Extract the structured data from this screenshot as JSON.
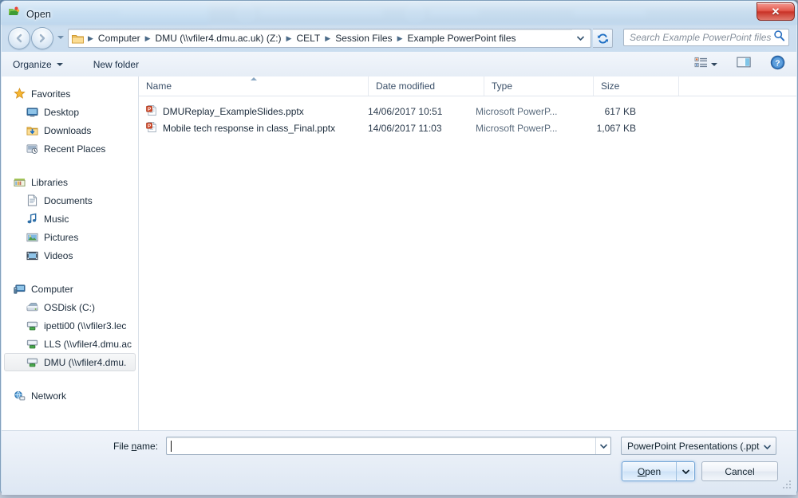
{
  "window": {
    "title": "Open",
    "close_label": "✕"
  },
  "navigation": {
    "back_label": "Back",
    "forward_label": "Forward",
    "recent_label": "Recent pages",
    "refresh_label": "Refresh",
    "breadcrumb": [
      "Computer",
      "DMU (\\\\vfiler4.dmu.ac.uk) (Z:)",
      "CELT",
      "Session Files",
      "Example PowerPoint files"
    ],
    "breadcrumb_separator": "▶"
  },
  "search": {
    "placeholder": "Search Example PowerPoint files"
  },
  "toolbar": {
    "organize_label": "Organize",
    "new_folder_label": "New folder",
    "view_label": "Change your view",
    "preview_label": "Show the preview pane",
    "help_label": "Get help"
  },
  "sidebar": {
    "groups": [
      {
        "header": {
          "label": "Favorites",
          "icon": "star-icon"
        },
        "items": [
          {
            "label": "Desktop",
            "icon": "desktop-icon"
          },
          {
            "label": "Downloads",
            "icon": "downloads-icon"
          },
          {
            "label": "Recent Places",
            "icon": "recent-places-icon"
          }
        ]
      },
      {
        "header": {
          "label": "Libraries",
          "icon": "libraries-icon"
        },
        "items": [
          {
            "label": "Documents",
            "icon": "documents-icon"
          },
          {
            "label": "Music",
            "icon": "music-icon"
          },
          {
            "label": "Pictures",
            "icon": "pictures-icon"
          },
          {
            "label": "Videos",
            "icon": "videos-icon"
          }
        ]
      },
      {
        "header": {
          "label": "Computer",
          "icon": "computer-icon"
        },
        "items": [
          {
            "label": "OSDisk (C:)",
            "icon": "harddisk-icon",
            "selected": false
          },
          {
            "label": "ipetti00 (\\\\vfiler3.lec",
            "icon": "network-drive-icon",
            "selected": false
          },
          {
            "label": "LLS (\\\\vfiler4.dmu.ac",
            "icon": "network-drive-icon",
            "selected": false
          },
          {
            "label": "DMU (\\\\vfiler4.dmu.",
            "icon": "network-drive-icon",
            "selected": true
          }
        ]
      },
      {
        "header": {
          "label": "Network",
          "icon": "network-icon"
        },
        "items": []
      }
    ]
  },
  "filelist": {
    "columns": [
      {
        "label": "Name",
        "sorted": true
      },
      {
        "label": "Date modified",
        "sorted": false
      },
      {
        "label": "Type",
        "sorted": false
      },
      {
        "label": "Size",
        "sorted": false
      }
    ],
    "rows": [
      {
        "name": "DMUReplay_ExampleSlides.pptx",
        "date": "14/06/2017 10:51",
        "type": "Microsoft PowerP...",
        "size": "617 KB",
        "icon": "powerpoint-file-icon"
      },
      {
        "name": "Mobile tech response in class_Final.pptx",
        "date": "14/06/2017 11:03",
        "type": "Microsoft PowerP...",
        "size": "1,067 KB",
        "icon": "powerpoint-file-icon"
      }
    ]
  },
  "bottom": {
    "filename_label_pre": "File ",
    "filename_label_accel": "n",
    "filename_label_post": "ame:",
    "filename_value": "",
    "filetype_value": "PowerPoint Presentations (.ppt",
    "open_label_accel": "O",
    "open_label_post": "pen",
    "cancel_label": "Cancel"
  },
  "colors": {
    "accent": "#2f73ae",
    "close_red": "#c93227",
    "powerpoint_orange": "#d24726",
    "selection_blue": "#cfe6fb"
  }
}
